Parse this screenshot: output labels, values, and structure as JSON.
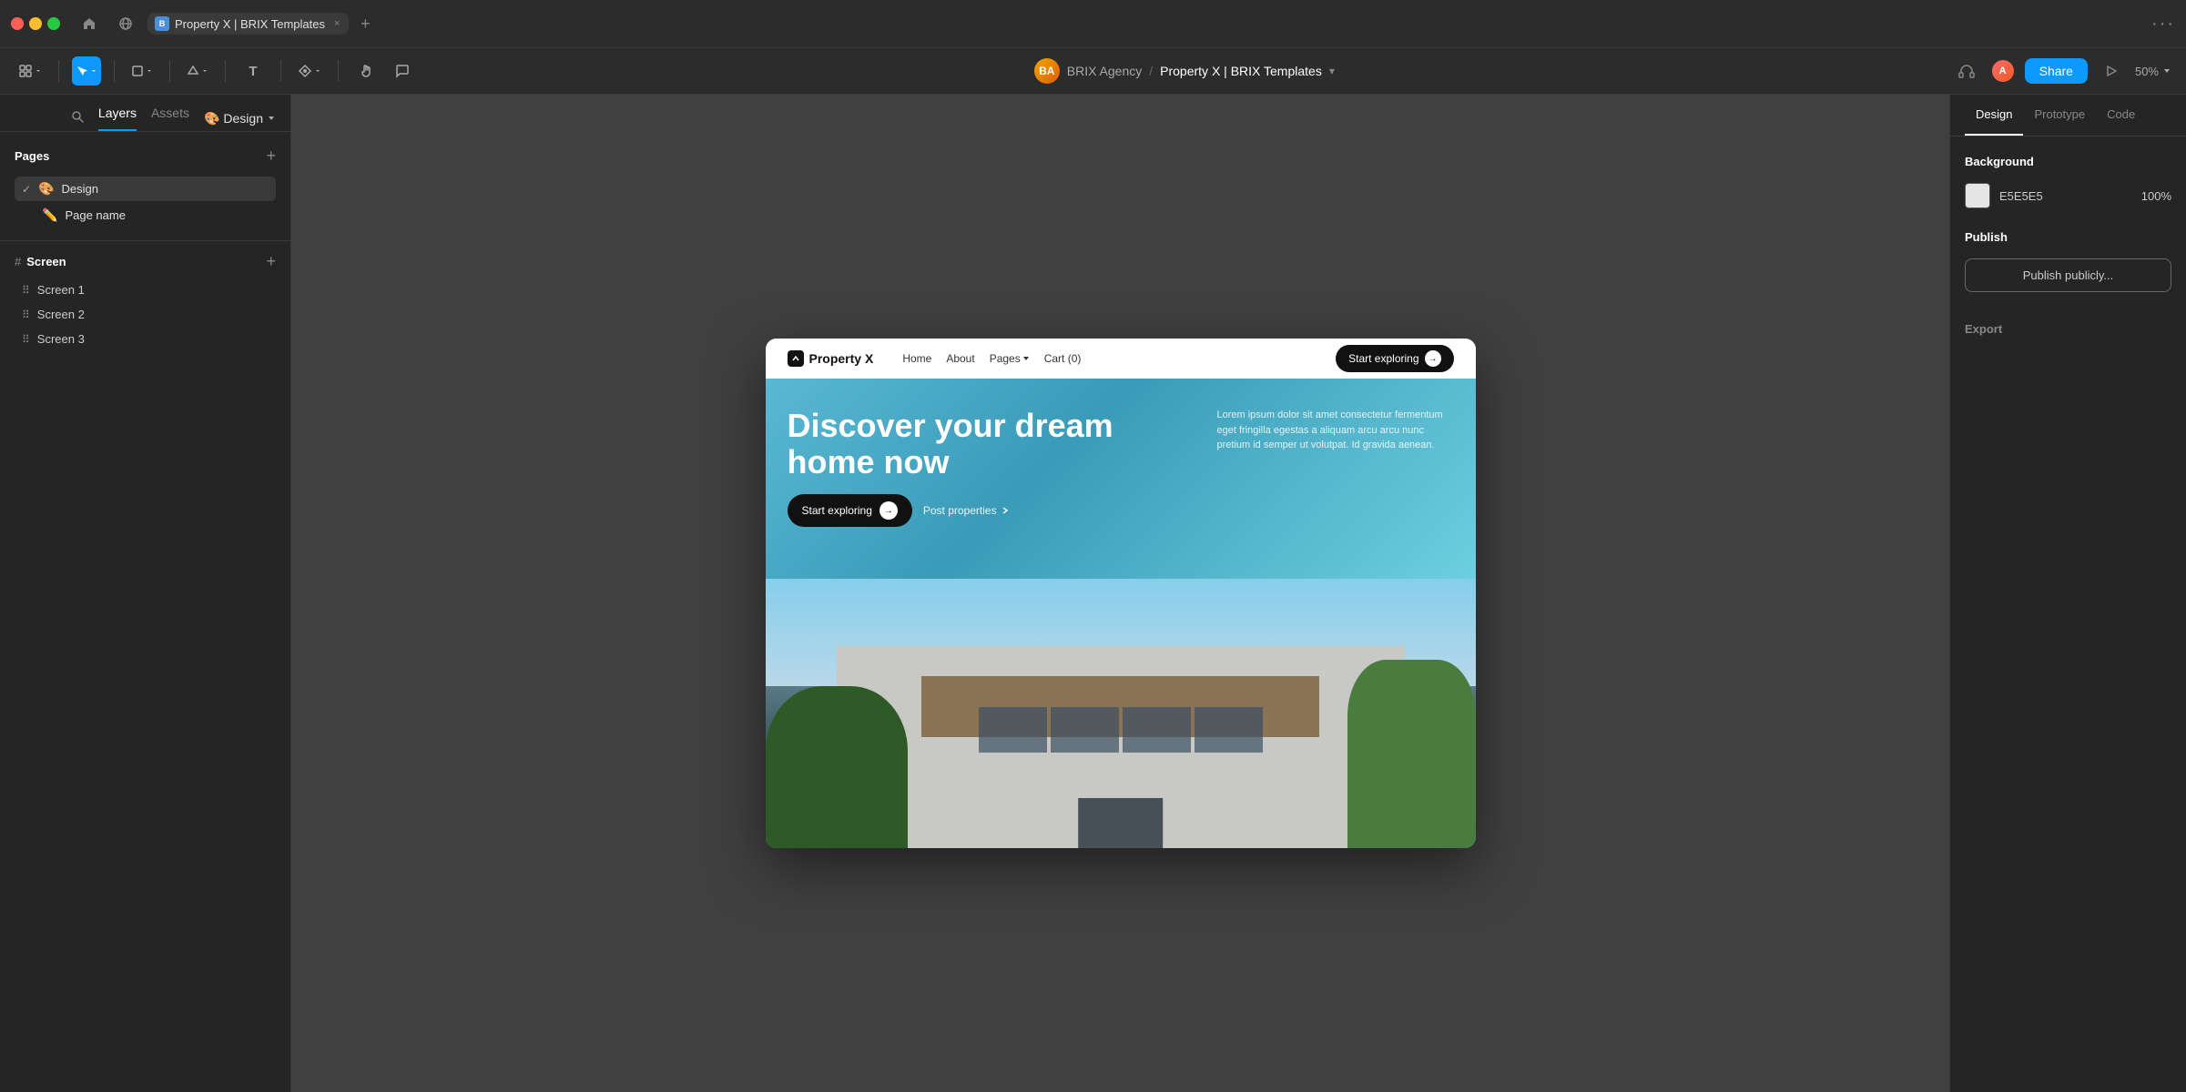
{
  "titleBar": {
    "windowBtns": [
      "close",
      "minimize",
      "maximize"
    ],
    "tab": {
      "favicon": "B",
      "label": "Property X | BRIX Templates",
      "closeBtn": "×"
    },
    "addTabBtn": "+",
    "moreBtn": "···"
  },
  "toolbar": {
    "tools": [
      {
        "id": "move",
        "label": "⊞",
        "active": false
      },
      {
        "id": "select",
        "label": "↖",
        "active": true
      },
      {
        "id": "frame",
        "label": "⬜",
        "active": false
      },
      {
        "id": "shape",
        "label": "◇",
        "active": false
      },
      {
        "id": "text",
        "label": "T",
        "active": false
      },
      {
        "id": "component",
        "label": "⊕",
        "active": false
      },
      {
        "id": "hand",
        "label": "✋",
        "active": false
      },
      {
        "id": "comment",
        "label": "💬",
        "active": false
      }
    ],
    "breadcrumb": {
      "brand": "BRIX Agency",
      "separator": "/",
      "project": "Property X | BRIX Templates",
      "chevron": "▾"
    },
    "right": {
      "headphones": "🎧",
      "share": "Share",
      "play": "▷",
      "zoom": "50%"
    }
  },
  "leftPanel": {
    "tabs": [
      {
        "label": "Layers",
        "active": true
      },
      {
        "label": "Assets",
        "active": false
      },
      {
        "label": "Design",
        "active": false,
        "emoji": "🎨"
      }
    ],
    "searchIcon": "🔍",
    "pages": {
      "title": "Pages",
      "addBtn": "+",
      "items": [
        {
          "label": "Design",
          "emoji": "🎨",
          "active": true,
          "hasCheck": true
        },
        {
          "label": "Page name",
          "emoji": "✏️",
          "active": false,
          "hasCheck": false,
          "subItem": true
        }
      ]
    },
    "screens": {
      "title": "Screen",
      "addBtn": "+",
      "items": [
        {
          "label": "Screen 1"
        },
        {
          "label": "Screen 2"
        },
        {
          "label": "Screen 3"
        }
      ]
    }
  },
  "canvas": {
    "website": {
      "nav": {
        "logo": "Property X",
        "links": [
          "Home",
          "About",
          "Pages ▾",
          "Cart (0)"
        ],
        "cta": "Start exploring",
        "ctaArrow": "→"
      },
      "hero": {
        "title": "Discover your dream home now",
        "bodyText": "Lorem ipsum dolor sit amet consectetur fermentum eget fringilla egestas a aliquam arcu arcu nunc pretium id semper ut volutpat. Id gravida aenean.",
        "ctaBtn": "Start exploring",
        "ctaArrow": "→",
        "postLink": "Post properties",
        "postArrow": ">"
      }
    }
  },
  "rightPanel": {
    "tabs": [
      "Design",
      "Prototype",
      "Code"
    ],
    "activeTab": "Design",
    "background": {
      "label": "Background",
      "color": "E5E5E5",
      "opacity": "100%"
    },
    "publish": {
      "label": "Publish",
      "btn": "Publish publicly..."
    },
    "export": {
      "label": "Export"
    }
  }
}
